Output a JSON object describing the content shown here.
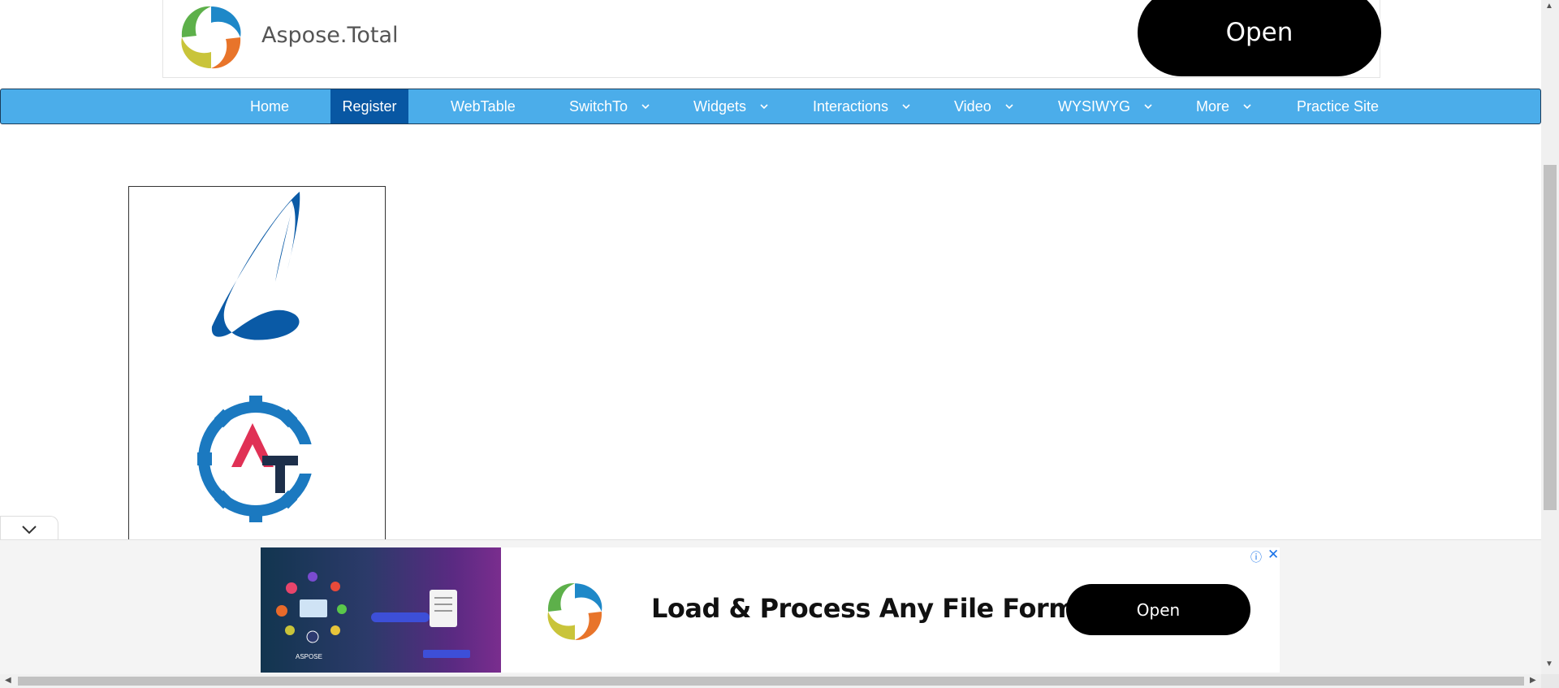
{
  "top_ad": {
    "brand": "Aspose.Total",
    "open_label": "Open",
    "logo_icon": "aspose-swirl-logo-icon"
  },
  "nav": {
    "items": [
      {
        "label": "Home",
        "has_dropdown": false,
        "active": false
      },
      {
        "label": "Register",
        "has_dropdown": false,
        "active": true
      },
      {
        "label": "WebTable",
        "has_dropdown": false,
        "active": false
      },
      {
        "label": "SwitchTo",
        "has_dropdown": true,
        "active": false
      },
      {
        "label": "Widgets",
        "has_dropdown": true,
        "active": false
      },
      {
        "label": "Interactions",
        "has_dropdown": true,
        "active": false
      },
      {
        "label": "Video",
        "has_dropdown": true,
        "active": false
      },
      {
        "label": "WYSIWYG",
        "has_dropdown": true,
        "active": false
      },
      {
        "label": "More",
        "has_dropdown": true,
        "active": false
      },
      {
        "label": "Practice Site",
        "has_dropdown": false,
        "active": false
      }
    ],
    "bar_color": "#4badea",
    "active_color": "#0857a3"
  },
  "logo_box": {
    "icons": [
      "s-brush-logo-icon",
      "at-gear-logo-icon"
    ]
  },
  "bottom_ad": {
    "headline": "Load & Process Any File Format",
    "open_label": "Open",
    "image_caption": "ASPOSE",
    "info_icon": "info-icon",
    "close_icon": "close-icon",
    "collapse_icon": "chevron-down-icon"
  }
}
